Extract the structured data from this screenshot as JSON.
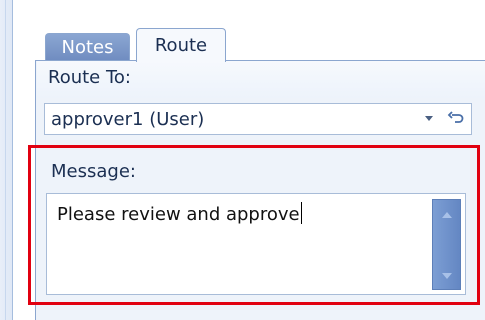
{
  "tabs": [
    {
      "label": "Notes",
      "active": false
    },
    {
      "label": "Route",
      "active": true
    }
  ],
  "route": {
    "label": "Route To:",
    "value": "approver1 (User)"
  },
  "message": {
    "label": "Message:",
    "value": "Please review and approve"
  },
  "icons": {
    "dropdown": "chevron-down-icon",
    "reset": "undo-icon"
  },
  "colors": {
    "highlight": "#e10010",
    "tab_active": "#f6f9fd",
    "tab_inactive": "#7f9bcb",
    "panel": "#eef3fa"
  }
}
